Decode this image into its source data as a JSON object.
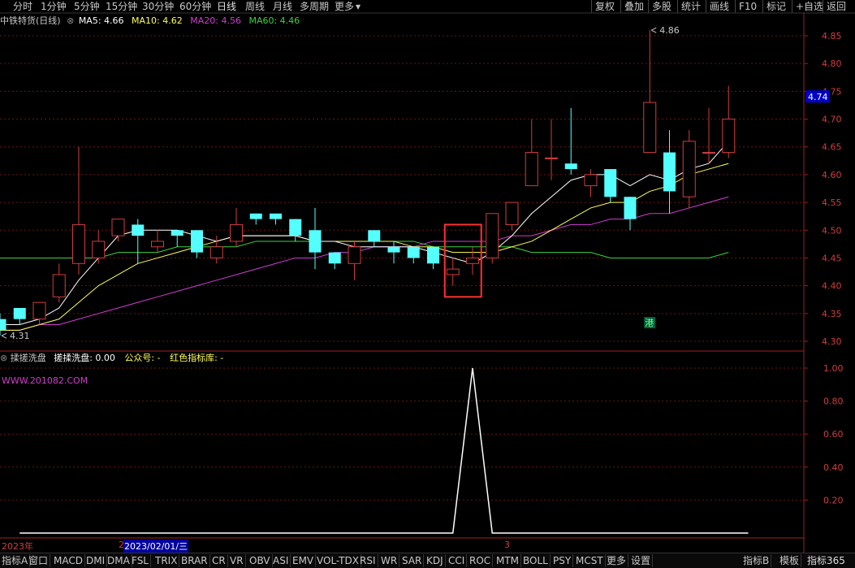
{
  "toolbar": {
    "left": [
      {
        "label": "分时",
        "x": 16
      },
      {
        "label": "1分钟",
        "x": 50
      },
      {
        "label": "5分钟",
        "x": 91
      },
      {
        "label": "15分钟",
        "x": 130
      },
      {
        "label": "30分钟",
        "x": 175
      },
      {
        "label": "60分钟",
        "x": 221
      },
      {
        "label": "日线",
        "x": 267,
        "active": true
      },
      {
        "label": "周线",
        "x": 302
      },
      {
        "label": "月线",
        "x": 336
      },
      {
        "label": "多周期",
        "x": 369
      },
      {
        "label": "更多",
        "x": 412
      }
    ],
    "dropdown_arrow": "▾",
    "right": [
      {
        "label": "复权",
        "x": 728
      },
      {
        "label": "叠加",
        "x": 764
      },
      {
        "label": "多股",
        "x": 798
      },
      {
        "label": "统计",
        "x": 834
      },
      {
        "label": "画线",
        "x": 869
      },
      {
        "label": "F10",
        "x": 905
      },
      {
        "label": "标记",
        "x": 939
      },
      {
        "label": "+自选",
        "x": 975
      },
      {
        "label": "返回",
        "x": 1013
      }
    ]
  },
  "legend": {
    "title": "中铁特货(日线)",
    "ma5": "MA5: 4.66",
    "ma10": "MA10: 4.62",
    "ma20": "MA20: 4.56",
    "ma60": "MA60: 4.46"
  },
  "colors": {
    "up": "#d23c3c",
    "down": "#54ffff",
    "ma5": "#ffffff",
    "ma10": "#ffff54",
    "ma20": "#d23cd2",
    "ma60": "#3cd23c",
    "axis": "#a02020",
    "label_red": "#d23c3c"
  },
  "price_axis": {
    "ticks": [
      "4.85",
      "4.80",
      "4.75",
      "4.70",
      "4.65",
      "4.60",
      "4.55",
      "4.50",
      "4.45",
      "4.40",
      "4.35",
      "4.30"
    ],
    "current": "4.74",
    "high_label": "4.86",
    "low_label": "4.31",
    "marker": "港"
  },
  "indicator": {
    "name": "揉搓洗盘",
    "value": "搓揉洗盘: 0.00",
    "gzh": "公众号: -",
    "lib": "红色指标库: -",
    "ticks": [
      "1.00",
      "0.80",
      "0.60",
      "0.40",
      "0.20"
    ],
    "site": "WWW.201082.COM"
  },
  "date_bar": {
    "year": "2023年",
    "m2": "2",
    "cursor_date": "2023/02/01/三",
    "m3": "3"
  },
  "tabs": [
    "指标A",
    "窗口",
    "MACD",
    "DMI",
    "DMA",
    "FSL",
    "TRIX",
    "BRAR",
    "CR",
    "VR",
    "OBV",
    "ASI",
    "EMV",
    "VOL-TDX",
    "RSI",
    "WR",
    "SAR",
    "KDJ",
    "CCI",
    "ROC",
    "MTM",
    "BOLL",
    "PSY",
    "MCST",
    "更多",
    "设置"
  ],
  "tabs_right": [
    "指标B",
    "模板"
  ],
  "watermark": "指标365",
  "chart_data": {
    "type": "candlestick",
    "ylim": [
      4.28,
      4.88
    ],
    "candles": [
      {
        "o": 4.34,
        "c": 4.32,
        "h": 4.35,
        "l": 4.31
      },
      {
        "o": 4.36,
        "c": 4.34,
        "h": 4.36,
        "l": 4.33
      },
      {
        "o": 4.34,
        "c": 4.37,
        "h": 4.37,
        "l": 4.33
      },
      {
        "o": 4.38,
        "c": 4.42,
        "h": 4.44,
        "l": 4.37
      },
      {
        "o": 4.44,
        "c": 4.51,
        "h": 4.65,
        "l": 4.42
      },
      {
        "o": 4.45,
        "c": 4.48,
        "h": 4.5,
        "l": 4.44
      },
      {
        "o": 4.49,
        "c": 4.52,
        "h": 4.52,
        "l": 4.48
      },
      {
        "o": 4.51,
        "c": 4.49,
        "h": 4.52,
        "l": 4.44
      },
      {
        "o": 4.47,
        "c": 4.48,
        "h": 4.5,
        "l": 4.46
      },
      {
        "o": 4.5,
        "c": 4.49,
        "h": 4.5,
        "l": 4.47
      },
      {
        "o": 4.5,
        "c": 4.46,
        "h": 4.5,
        "l": 4.45
      },
      {
        "o": 4.45,
        "c": 4.47,
        "h": 4.49,
        "l": 4.44
      },
      {
        "o": 4.48,
        "c": 4.51,
        "h": 4.54,
        "l": 4.47
      },
      {
        "o": 4.53,
        "c": 4.52,
        "h": 4.53,
        "l": 4.51
      },
      {
        "o": 4.53,
        "c": 4.52,
        "h": 4.53,
        "l": 4.51
      },
      {
        "o": 4.52,
        "c": 4.49,
        "h": 4.52,
        "l": 4.48
      },
      {
        "o": 4.5,
        "c": 4.46,
        "h": 4.54,
        "l": 4.43
      },
      {
        "o": 4.46,
        "c": 4.44,
        "h": 4.46,
        "l": 4.43
      },
      {
        "o": 4.44,
        "c": 4.47,
        "h": 4.48,
        "l": 4.41
      },
      {
        "o": 4.5,
        "c": 4.48,
        "h": 4.5,
        "l": 4.47
      },
      {
        "o": 4.47,
        "c": 4.46,
        "h": 4.48,
        "l": 4.44
      },
      {
        "o": 4.47,
        "c": 4.45,
        "h": 4.47,
        "l": 4.44
      },
      {
        "o": 4.47,
        "c": 4.44,
        "h": 4.47,
        "l": 4.43
      },
      {
        "o": 4.42,
        "c": 4.43,
        "h": 4.45,
        "l": 4.4
      },
      {
        "o": 4.44,
        "c": 4.45,
        "h": 4.47,
        "l": 4.42
      },
      {
        "o": 4.45,
        "c": 4.53,
        "h": 4.53,
        "l": 4.44
      },
      {
        "o": 4.51,
        "c": 4.55,
        "h": 4.55,
        "l": 4.5
      },
      {
        "o": 4.58,
        "c": 4.64,
        "h": 4.7,
        "l": 4.58
      },
      {
        "o": 4.63,
        "c": 4.63,
        "h": 4.7,
        "l": 4.59
      },
      {
        "o": 4.62,
        "c": 4.61,
        "h": 4.72,
        "l": 4.6
      },
      {
        "o": 4.58,
        "c": 4.6,
        "h": 4.61,
        "l": 4.56
      },
      {
        "o": 4.61,
        "c": 4.56,
        "h": 4.61,
        "l": 4.55
      },
      {
        "o": 4.56,
        "c": 4.52,
        "h": 4.56,
        "l": 4.5
      },
      {
        "o": 4.64,
        "c": 4.73,
        "h": 4.86,
        "l": 4.64
      },
      {
        "o": 4.64,
        "c": 4.57,
        "h": 4.68,
        "l": 4.53
      },
      {
        "o": 4.56,
        "c": 4.66,
        "h": 4.68,
        "l": 4.54
      },
      {
        "o": 4.64,
        "c": 4.64,
        "h": 4.72,
        "l": 4.62
      },
      {
        "o": 4.64,
        "c": 4.7,
        "h": 4.76,
        "l": 4.63
      }
    ],
    "ma5": [
      4.33,
      4.33,
      4.34,
      4.36,
      4.41,
      4.45,
      4.49,
      4.5,
      4.5,
      4.5,
      4.49,
      4.48,
      4.49,
      4.49,
      4.49,
      4.49,
      4.48,
      4.48,
      4.47,
      4.47,
      4.47,
      4.47,
      4.46,
      4.45,
      4.44,
      4.46,
      4.49,
      4.53,
      4.56,
      4.59,
      4.6,
      4.6,
      4.58,
      4.6,
      4.59,
      4.61,
      4.62,
      4.66
    ],
    "ma10": [
      4.32,
      4.32,
      4.33,
      4.34,
      4.37,
      4.4,
      4.42,
      4.44,
      4.45,
      4.46,
      4.47,
      4.48,
      4.49,
      4.49,
      4.49,
      4.49,
      4.48,
      4.48,
      4.48,
      4.48,
      4.48,
      4.47,
      4.47,
      4.46,
      4.46,
      4.46,
      4.47,
      4.48,
      4.5,
      4.52,
      4.54,
      4.55,
      4.55,
      4.57,
      4.58,
      4.6,
      4.61,
      4.62
    ],
    "ma20": [
      4.32,
      4.32,
      4.33,
      4.33,
      4.34,
      4.35,
      4.36,
      4.37,
      4.38,
      4.39,
      4.4,
      4.41,
      4.42,
      4.43,
      4.44,
      4.45,
      4.45,
      4.46,
      4.46,
      4.47,
      4.47,
      4.47,
      4.48,
      4.48,
      4.48,
      4.48,
      4.49,
      4.49,
      4.5,
      4.51,
      4.51,
      4.52,
      4.52,
      4.53,
      4.53,
      4.54,
      4.55,
      4.56
    ],
    "ma60": [
      4.45,
      4.45,
      4.45,
      4.45,
      4.45,
      4.45,
      4.46,
      4.46,
      4.46,
      4.47,
      4.47,
      4.47,
      4.47,
      4.48,
      4.48,
      4.48,
      4.48,
      4.48,
      4.48,
      4.48,
      4.48,
      4.48,
      4.47,
      4.47,
      4.47,
      4.47,
      4.47,
      4.46,
      4.46,
      4.46,
      4.46,
      4.45,
      4.45,
      4.45,
      4.45,
      4.45,
      4.45,
      4.46
    ],
    "indicator_values": [
      0,
      0,
      0,
      0,
      0,
      0,
      0,
      0,
      0,
      0,
      0,
      0,
      0,
      0,
      0,
      0,
      0,
      0,
      0,
      0,
      0,
      0,
      0,
      1,
      0,
      0,
      0,
      0,
      0,
      0,
      0,
      0,
      0,
      0,
      0,
      0,
      0,
      0
    ],
    "highlight_index": 23
  }
}
